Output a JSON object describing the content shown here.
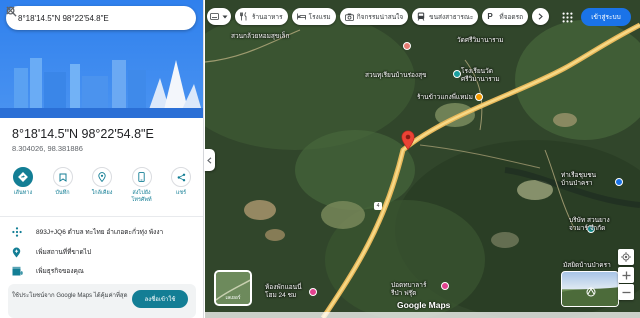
{
  "search": {
    "query": "8°18'14.5\"N 98°22'54.8\"E"
  },
  "place": {
    "title": "8°18'14.5\"N 98°22'54.8\"E",
    "coords": "8.304026, 98.381886"
  },
  "actions": [
    {
      "label": "เส้นทาง",
      "icon": "directions-icon"
    },
    {
      "label": "บันทึก",
      "icon": "bookmark-icon"
    },
    {
      "label": "ใกล้เคียง",
      "icon": "nearby-icon"
    },
    {
      "label": "ส่งไปยังโทรศัพท์",
      "icon": "send-to-phone-icon"
    },
    {
      "label": "แชร์",
      "icon": "share-icon"
    }
  ],
  "info": {
    "plus_code": "893J+JQ6 ตำบล ทะไทย อำเภอตะกั่วทุ่ง พังงา",
    "add_place": "เพิ่มสถานที่ที่ขาดไป",
    "add_business": "เพิ่มธุรกิจของคุณ"
  },
  "banner": {
    "text": "ใช้ประโยชน์จาก Google Maps ได้คุ้มค่าที่สุด",
    "button": "ลงชื่อเข้าใช้"
  },
  "chips": [
    {
      "label": "ร้านอาหาร",
      "icon": "restaurant-icon"
    },
    {
      "label": "โรงแรม",
      "icon": "hotel-icon"
    },
    {
      "label": "กิจกรรมน่าสนใจ",
      "icon": "camera-icon"
    },
    {
      "label": "ขนส่งสาธารณะ",
      "icon": "transit-icon"
    },
    {
      "label": "ที่จอดรถ",
      "icon": "parking-icon"
    }
  ],
  "signin_label": "เข้าสู่ระบบ",
  "map_labels": {
    "a": "สวนกล้วยหอมสุขเล็ก",
    "b": "วัดศรีวิมานาราม",
    "c": "โรงเรียนวัด\nศรีวิมานาราม",
    "d": "สวนทุเรียนบ้านร่องสุข",
    "e": "ร้านข้าวแกงพี่แหม่ม",
    "f": "ท่าเรือชุมชน\nบ้านป่าครา",
    "g": "บริษัท สวนยาง\nจามาร์ จำกัด",
    "h": "มัสยิดบ้านป่าครา",
    "i": "ห้องพักแอนนี่\nโฮม 24 ชม",
    "j": "ปอตทบาลาร์\nรีป่า ฟรุ๊ต"
  },
  "layers_label": "เลเยอร์",
  "google_logo": "Google Maps",
  "colors": {
    "accent": "#137e95",
    "signin": "#1a73e8",
    "pin": "#ea4335",
    "road": "#f2c469"
  }
}
